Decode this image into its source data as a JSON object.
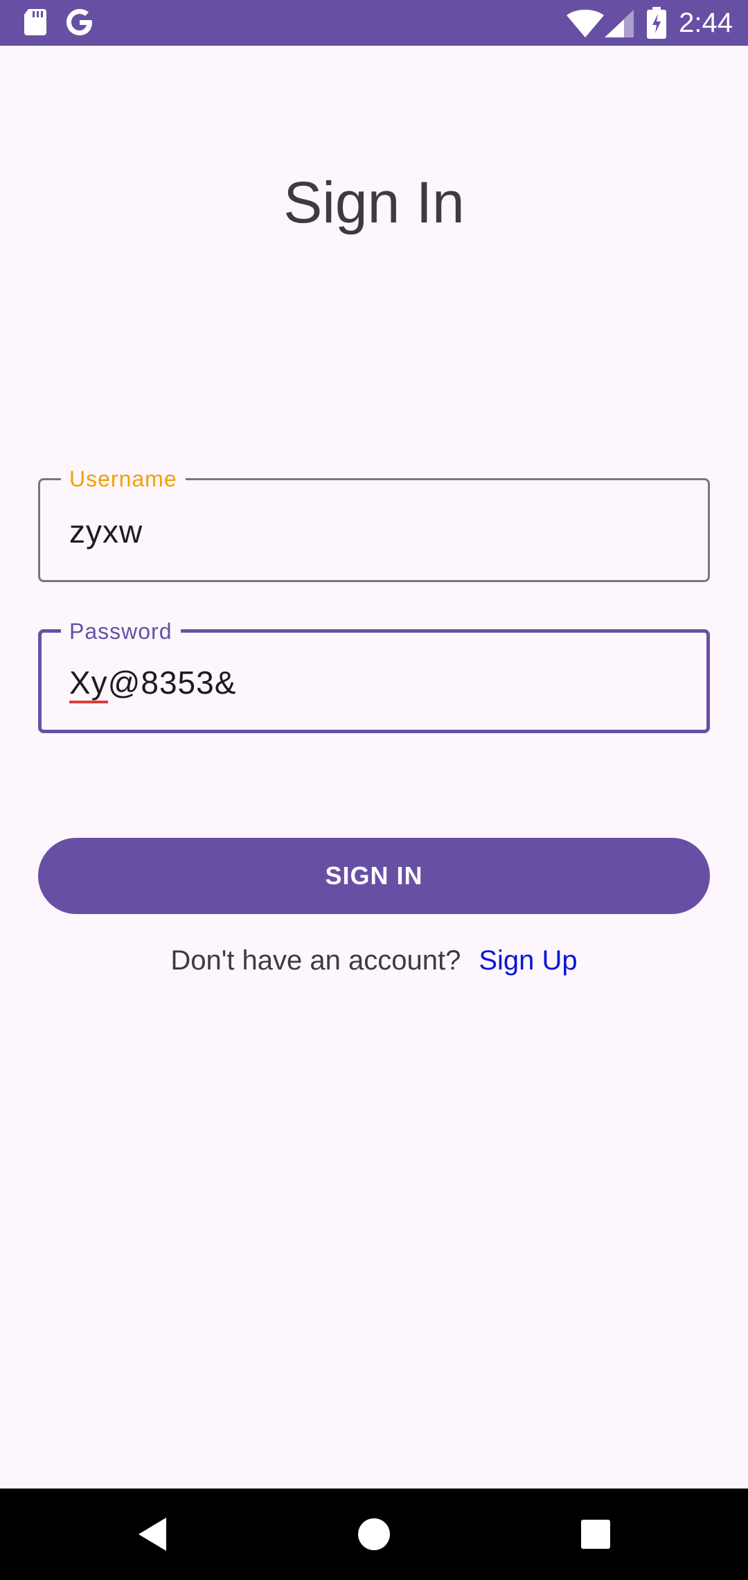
{
  "status_bar": {
    "time": "2:44",
    "left_icons": [
      "sd-card-icon",
      "google-icon"
    ],
    "right_icons": [
      "wifi-icon",
      "signal-icon",
      "battery-charging-icon"
    ],
    "background": "#6750a4"
  },
  "page": {
    "title": "Sign In"
  },
  "form": {
    "username": {
      "label": "Username",
      "value": "zyxw",
      "label_color": "#f49f00"
    },
    "password": {
      "label": "Password",
      "value_underlined": "Xy",
      "value_rest": "@8353&",
      "focused": true,
      "accent_color": "#6750a4"
    },
    "submit_label": "SIGN IN"
  },
  "signup": {
    "prompt": "Don't have an account?",
    "link": "Sign Up",
    "link_color": "#0b16d6"
  },
  "nav_bar": {
    "buttons": [
      "back-icon",
      "home-icon",
      "recents-icon"
    ]
  }
}
